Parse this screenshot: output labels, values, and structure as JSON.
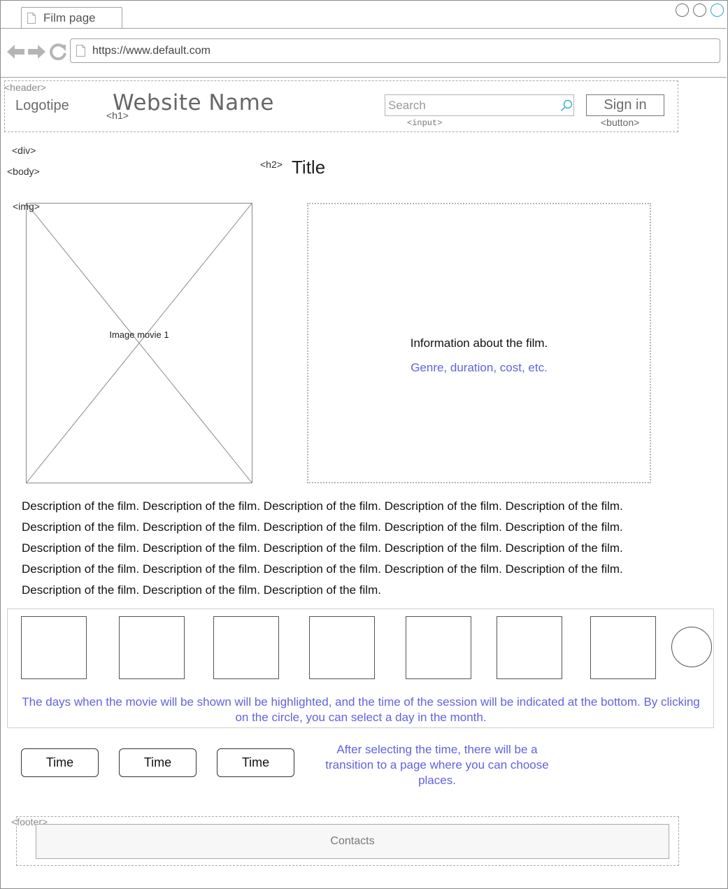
{
  "browser": {
    "tab_title": "Film page",
    "url": "https://www.default.com"
  },
  "tags": {
    "header": "<header>",
    "h1": "<h1>",
    "input": "<input>",
    "button": "<button>",
    "div": "<div>",
    "body": "<body>",
    "h2": "<h2>",
    "img": "<img>",
    "footer": "<footer>"
  },
  "header": {
    "logo": "Logotipe",
    "site_name": "Website Name",
    "search_placeholder": "Search",
    "sign_in": "Sign in"
  },
  "main": {
    "title": "Title",
    "image_label": "Image movie 1",
    "info_main": "Information about the film.",
    "info_sub": "Genre, duration, cost, etc.",
    "description": "Description of the film. Description of the film. Description of the film. Description of the film. Description of the film. Description of the film. Description of the film. Description of the film. Description of the film. Description of the film. Description of the film. Description of the film. Description of the film. Description of the film. Description of the film. Description of the film. Description of the film. Description of the film. Description of the film. Description of the film. Description of the film. Description of the film. Description of the film."
  },
  "days": {
    "note": "The days when the movie will be shown will be highlighted, and the time of the session will be indicated at the bottom. By clicking on the circle, you can select a day in the month."
  },
  "times": {
    "buttons": [
      "Time",
      "Time",
      "Time"
    ],
    "note": "After selecting the time, there will be a transition to a page where you can choose places."
  },
  "footer": {
    "contacts": "Contacts"
  },
  "colors": {
    "accent_text": "#6262e0",
    "window_button_active": "#2aa6d6"
  }
}
